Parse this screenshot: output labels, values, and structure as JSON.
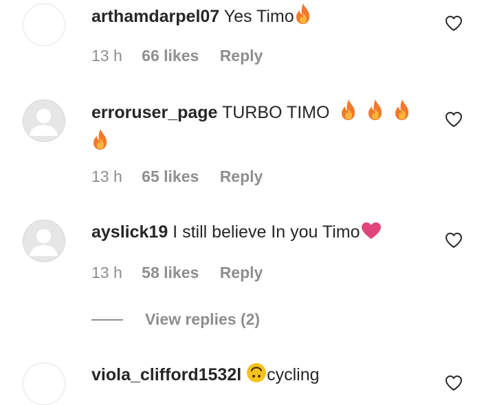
{
  "comments": [
    {
      "username": "arthamdarpel07",
      "text": "Yes Timo",
      "emoji": [
        "fire-emoji"
      ],
      "time": "13 h",
      "likes": "66 likes",
      "reply": "Reply",
      "avatar": "blank-avatar"
    },
    {
      "username": "erroruser_page",
      "text": "TURBO TIMO",
      "emoji": [
        "fire-emoji",
        "fire-emoji",
        "fire-emoji",
        "fire-emoji"
      ],
      "time": "13 h",
      "likes": "65 likes",
      "reply": "Reply",
      "avatar": "default-user-avatar"
    },
    {
      "username": "ayslick19",
      "text": "I still believe In you Timo",
      "emoji": [
        "pink-heart-emoji"
      ],
      "time": "13 h",
      "likes": "58 likes",
      "reply": "Reply",
      "avatar": "default-user-avatar"
    },
    {
      "username": "viola_clifford1532l",
      "text": "cycling",
      "emoji": [
        "upside-down-face-emoji"
      ],
      "avatar": "blank-avatar"
    }
  ],
  "view_replies": "View replies (2)",
  "colors": {
    "text": "#262626",
    "secondary": "#8e8e8e",
    "fire": "#f2792a",
    "heart": "#e0457b",
    "emoji_face": "#f7c21d"
  }
}
